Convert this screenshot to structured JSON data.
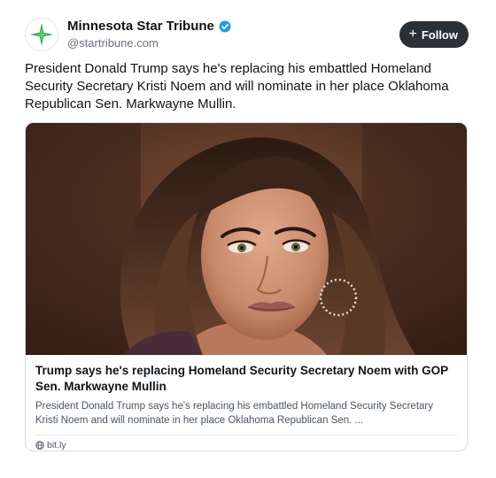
{
  "author": {
    "display_name": "Minnesota Star Tribune",
    "handle": "@startribune.com",
    "verified": true,
    "avatar_icon": "star-logo-icon",
    "brand_color": "#2ba84a"
  },
  "follow_button": {
    "label": "Follow",
    "icon": "plus-icon"
  },
  "post": {
    "text": "President Donald Trump says he's replacing his embattled Homeland Security Secretary Kristi Noem and will nominate in her place Oklahoma Republican Sen. Markwayne Mullin."
  },
  "link_card": {
    "title": "Trump says he's replacing Homeland Security Secretary Noem with GOP Sen. Markwayne Mullin",
    "description": "President Donald Trump says he's replacing his embattled Homeland Security Secretary Kristi Noem and will nominate in her place Oklahoma Republican Sen. ...",
    "domain": "bit.ly",
    "domain_icon": "globe-icon"
  },
  "colors": {
    "verified_badge": "#1d9bf0",
    "follow_bg": "#2b2f36"
  }
}
